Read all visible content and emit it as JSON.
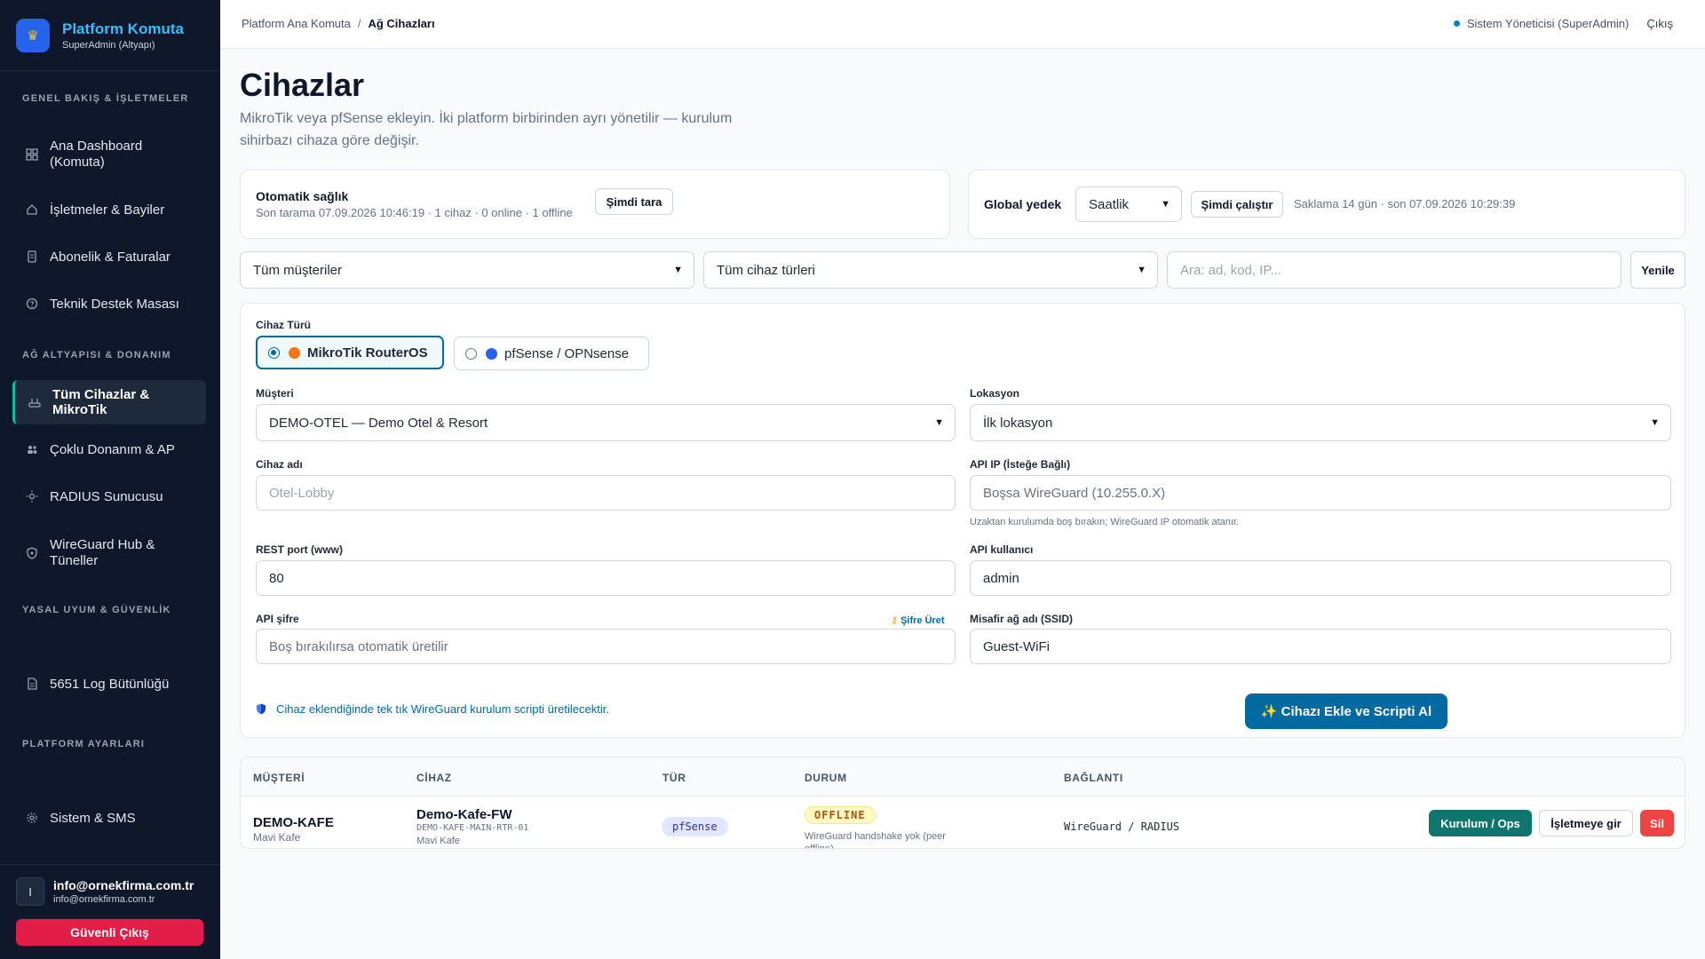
{
  "brand": {
    "title": "Platform Komuta",
    "subtitle": "SuperAdmin (Altyapı)",
    "logo_icon": "crown-icon"
  },
  "sidebar": {
    "sections": [
      "GENEL BAKIŞ & İŞLETMELER",
      "AĞ ALTYAPISI & DONANIM",
      "YASAL UYUM & GÜVENLİK",
      "PLATFORM AYARLARI"
    ],
    "items": [
      {
        "label": "Ana Dashboard (Komuta)",
        "icon": "grid-icon"
      },
      {
        "label": "İşletmeler & Bayiler",
        "icon": "home-icon"
      },
      {
        "label": "Abonelik & Faturalar",
        "icon": "document-icon"
      },
      {
        "label": "Teknik Destek Masası",
        "icon": "help-icon"
      },
      {
        "label": "Tüm Cihazlar & MikroTik",
        "icon": "router-icon"
      },
      {
        "label": "Çoklu Donanım & AP",
        "icon": "users-icon"
      },
      {
        "label": "RADIUS Sunucusu",
        "icon": "sun-icon"
      },
      {
        "label": "WireGuard Hub & Tüneller",
        "icon": "shield-icon"
      },
      {
        "label": "5651 Log Bütünlüğü",
        "icon": "file-icon"
      },
      {
        "label": "Sistem & SMS",
        "icon": "gear-icon"
      }
    ],
    "active_index": 4,
    "user": {
      "initial": "I",
      "name": "info@ornekfirma.com.tr",
      "email": "info@ornekfirma.com.tr"
    },
    "logout_label": "Güvenli Çıkış"
  },
  "topbar": {
    "breadcrumb_root": "Platform Ana Komuta",
    "breadcrumb_sep": "/",
    "breadcrumb_current": "Ağ Cihazları",
    "status_user": "Sistem Yöneticisi (SuperAdmin)",
    "logout": "Çıkış"
  },
  "page": {
    "title": "Cihazlar",
    "subtitle": "MikroTik veya pfSense ekleyin. İki platform birbirinden ayrı yönetilir — kurulum sihirbazı cihaza göre değişir."
  },
  "health": {
    "title": "Otomatik sağlık",
    "last_scan": "Son tarama 07.09.2026 10:46:19 · 1 cihaz · 0 online · 1 offline",
    "scan_button": "Şimdi tara"
  },
  "backup": {
    "title": "Global yedek",
    "frequency": "Saatlik",
    "run_button": "Şimdi çalıştır",
    "info": "Saklama 14 gün · son 07.09.2026 10:29:39"
  },
  "filters": {
    "customer": "Tüm müşteriler",
    "device_type": "Tüm cihaz türleri",
    "search_placeholder": "Ara: ad, kod, IP...",
    "refresh": "Yenile"
  },
  "form": {
    "device_type_label": "Cihaz Türü",
    "options": [
      {
        "label": "MikroTik RouterOS",
        "color": "#f97316",
        "selected": true
      },
      {
        "label": "pfSense / OPNsense",
        "color": "#2563eb",
        "selected": false
      }
    ],
    "customer_label": "Müşteri",
    "customer_value": "DEMO-OTEL — Demo Otel & Resort",
    "location_label": "Lokasyon",
    "location_value": "İlk lokasyon",
    "name_label": "Cihaz adı",
    "name_placeholder": "Otel-Lobby",
    "api_ip_label": "API IP (İsteğe Bağlı)",
    "api_ip_placeholder": "Boşsa WireGuard (10.255.0.X)",
    "api_ip_hint": "Uzaktan kurulumda boş bırakın; WireGuard IP otomatik atanır.",
    "rest_port_label": "REST port (www)",
    "rest_port_value": "80",
    "api_user_label": "API kullanıcı",
    "api_user_value": "admin",
    "api_pass_label": "API şifre",
    "api_pass_placeholder": "Boş bırakılırsa otomatik üretilir",
    "gen_pass": "Şifre Üret",
    "ssid_label": "Misafir ağ adı (SSID)",
    "ssid_value": "Guest-WiFi",
    "note": "Cihaz eklendiğinde tek tık WireGuard kurulum scripti üretilecektir.",
    "submit": "Cihazı Ekle ve Scripti Al"
  },
  "table": {
    "headers": [
      "MÜŞTERİ",
      "CİHAZ",
      "TÜR",
      "DURUM",
      "BAĞLANTI"
    ],
    "rows": [
      {
        "customer": "DEMO-KAFE",
        "customer_sub": "Mavi Kafe",
        "device": "Demo-Kafe-FW",
        "device_code": "DEMO-KAFE-MAIN-RTR-01",
        "device_sub": "Mavi Kafe",
        "type": "pfSense",
        "status": "OFFLINE",
        "status_note": "WireGuard handshake yok (peer offline)",
        "connection": "WireGuard / RADIUS",
        "actions": [
          "Kurulum / Ops",
          "İşletmeye gir",
          "Sil"
        ]
      }
    ]
  }
}
